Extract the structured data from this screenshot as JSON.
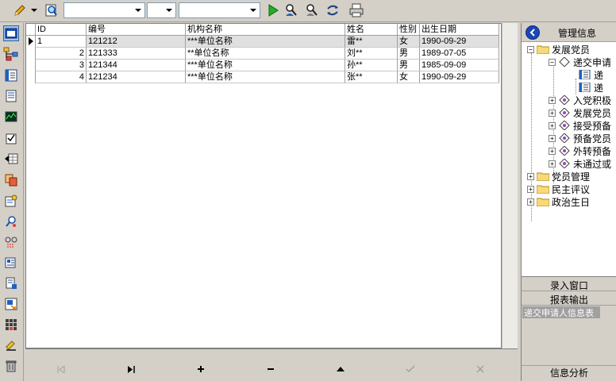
{
  "toolbar": {
    "combo1_value": "",
    "combo2_value": "",
    "combo3_value": ""
  },
  "grid": {
    "columns": [
      "ID",
      "编号",
      "机构名称",
      "姓名",
      "性别",
      "出生日期"
    ],
    "rows": [
      {
        "id": "1",
        "code": "121212",
        "org": "***单位名称",
        "name": "雷**",
        "gender": "女",
        "birth": "1990-09-29"
      },
      {
        "id": "2",
        "code": "121333",
        "org": "**单位名称",
        "name": "刘**",
        "gender": "男",
        "birth": "1989-07-05"
      },
      {
        "id": "3",
        "code": "121344",
        "org": "***单位名称",
        "name": "孙**",
        "gender": "男",
        "birth": "1985-09-09"
      },
      {
        "id": "4",
        "code": "121234",
        "org": "***单位名称",
        "name": "张**",
        "gender": "女",
        "birth": "1990-09-29"
      }
    ]
  },
  "panel": {
    "title": "管理信息",
    "tree": {
      "root": "发展党员",
      "child_open": "递交申请",
      "leaf1": "递",
      "leaf2": "递",
      "items": [
        "入党积极",
        "发展党员",
        "接受预备",
        "预备党员",
        "外转预备",
        "未通过或"
      ],
      "top_items": [
        "党员管理",
        "民主评议",
        "政治生日"
      ]
    },
    "menu": {
      "entry_window": "录入窗口",
      "report_output": "报表输出",
      "selected_report": "递交申请人信息表",
      "info_analysis": "信息分析"
    }
  }
}
